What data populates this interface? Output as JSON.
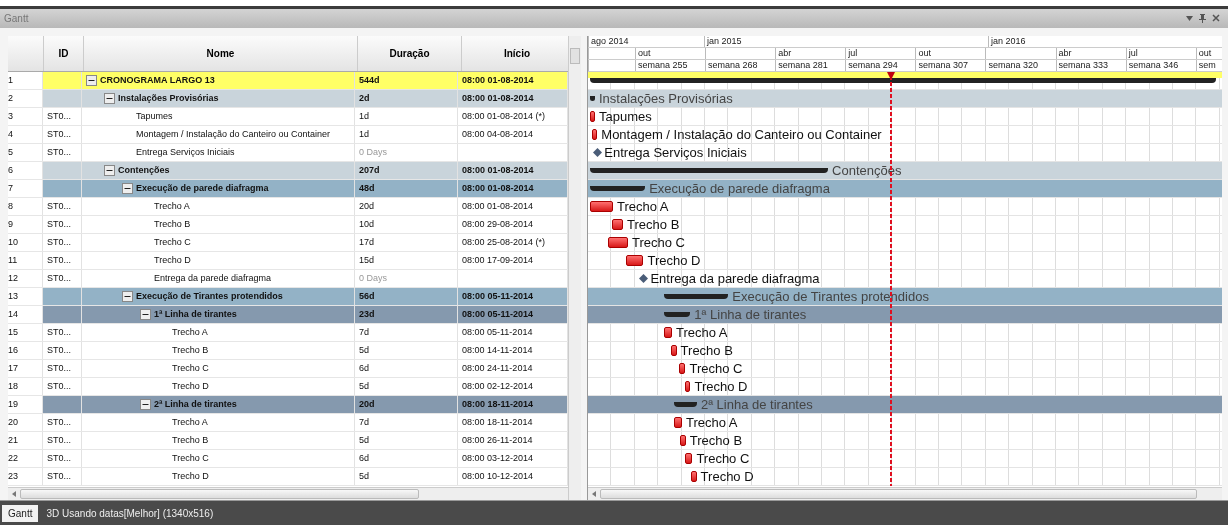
{
  "window": {
    "title": "Gantt"
  },
  "columns": [
    "ID",
    "Nome",
    "Duração",
    "Início"
  ],
  "timeline": {
    "years": [
      "ago 2014",
      "jan 2015",
      "jan 2016"
    ],
    "months": [
      "out",
      "abr",
      "jul",
      "out",
      "abr",
      "jul",
      "out"
    ],
    "weeks": [
      "semana 255",
      "semana 268",
      "semana 281",
      "semana 294",
      "semana 307",
      "semana 320",
      "semana 333",
      "semana 346",
      "sem"
    ]
  },
  "tasks": [
    {
      "kind": "summary",
      "num": "1",
      "name": "CRONOGRAMA LARGO 13",
      "duration": "544d",
      "start": "08:00 01-08-2014",
      "expanded": true,
      "children": [
        {
          "kind": "summary",
          "num": "2",
          "name": "Instalações Provisórias",
          "duration": "2d",
          "start": "08:00 01-08-2014",
          "bar_label": "Instalações Provisórias",
          "expanded": true,
          "children": [
            {
              "kind": "task",
              "num": "3",
              "id": "ST0...",
              "name": "Tapumes",
              "duration": "1d",
              "start": "08:00 01-08-2014 (*)",
              "bar_label": "Tapumes"
            },
            {
              "kind": "task",
              "num": "4",
              "id": "ST0...",
              "name": "Montagem / Instalação do Canteiro ou Container",
              "duration": "1d",
              "start": "08:00 04-08-2014",
              "bar_label": "Montagem / Instalação do Canteiro ou Container"
            },
            {
              "kind": "milestone",
              "num": "5",
              "id": "ST0...",
              "name": "Entrega Serviços Iniciais",
              "duration": "0 Days",
              "bar_label": "Entrega Serviços Iniciais"
            }
          ]
        },
        {
          "kind": "summary",
          "num": "6",
          "name": "Contenções",
          "duration": "207d",
          "start": "08:00 01-08-2014",
          "bar_label": "Contenções",
          "expanded": true,
          "children": [
            {
              "kind": "summary",
              "num": "7",
              "name": "Execução de parede diafragma",
              "duration": "48d",
              "start": "08:00 01-08-2014",
              "bar_label": "Execução de parede diafragma",
              "expanded": true,
              "children": [
                {
                  "kind": "task",
                  "num": "8",
                  "id": "ST0...",
                  "name": "Trecho A",
                  "duration": "20d",
                  "start": "08:00 01-08-2014",
                  "bar_label": "Trecho A"
                },
                {
                  "kind": "task",
                  "num": "9",
                  "id": "ST0...",
                  "name": "Trecho B",
                  "duration": "10d",
                  "start": "08:00 29-08-2014",
                  "bar_label": "Trecho B"
                },
                {
                  "kind": "task",
                  "num": "10",
                  "id": "ST0...",
                  "name": "Trecho C",
                  "duration": "17d",
                  "start": "08:00 25-08-2014 (*)",
                  "bar_label": "Trecho C"
                },
                {
                  "kind": "task",
                  "num": "11",
                  "id": "ST0...",
                  "name": "Trecho D",
                  "duration": "15d",
                  "start": "08:00 17-09-2014",
                  "bar_label": "Trecho D"
                },
                {
                  "kind": "milestone",
                  "num": "12",
                  "id": "ST0...",
                  "name": "Entrega da parede diafragma",
                  "duration": "0 Days",
                  "bar_label": "Entrega da parede diafragma"
                }
              ]
            },
            {
              "kind": "summary",
              "num": "13",
              "name": "Execução de Tirantes protendidos",
              "duration": "56d",
              "start": "08:00 05-11-2014",
              "bar_label": "Execução de Tirantes protendidos",
              "expanded": true,
              "children": [
                {
                  "kind": "summary",
                  "num": "14",
                  "name": "1ª Linha de tirantes",
                  "duration": "23d",
                  "start": "08:00 05-11-2014",
                  "bar_label": "1ª Linha de tirantes",
                  "expanded": true,
                  "children": [
                    {
                      "kind": "task",
                      "num": "15",
                      "id": "ST0...",
                      "name": "Trecho A",
                      "duration": "7d",
                      "start": "08:00 05-11-2014",
                      "bar_label": "Trecho A"
                    },
                    {
                      "kind": "task",
                      "num": "16",
                      "id": "ST0...",
                      "name": "Trecho B",
                      "duration": "5d",
                      "start": "08:00 14-11-2014",
                      "bar_label": "Trecho B"
                    },
                    {
                      "kind": "task",
                      "num": "17",
                      "id": "ST0...",
                      "name": "Trecho C",
                      "duration": "6d",
                      "start": "08:00 24-11-2014",
                      "bar_label": "Trecho C"
                    },
                    {
                      "kind": "task",
                      "num": "18",
                      "id": "ST0...",
                      "name": "Trecho D",
                      "duration": "5d",
                      "start": "08:00 02-12-2014",
                      "bar_label": "Trecho D"
                    }
                  ]
                },
                {
                  "kind": "summary",
                  "num": "19",
                  "name": "2ª Linha de tirantes",
                  "duration": "20d",
                  "start": "08:00 18-11-2014",
                  "bar_label": "2ª Linha de tirantes",
                  "expanded": true,
                  "children": [
                    {
                      "kind": "task",
                      "num": "20",
                      "id": "ST0...",
                      "name": "Trecho A",
                      "duration": "7d",
                      "start": "08:00 18-11-2014",
                      "bar_label": "Trecho A"
                    },
                    {
                      "kind": "task",
                      "num": "21",
                      "id": "ST0...",
                      "name": "Trecho B",
                      "duration": "5d",
                      "start": "08:00 26-11-2014",
                      "bar_label": "Trecho B"
                    },
                    {
                      "kind": "task",
                      "num": "22",
                      "id": "ST0...",
                      "name": "Trecho C",
                      "duration": "6d",
                      "start": "08:00 03-12-2014",
                      "bar_label": "Trecho C"
                    },
                    {
                      "kind": "task",
                      "num": "23",
                      "id": "ST0...",
                      "name": "Trecho D",
                      "duration": "5d",
                      "start": "08:00 10-12-2014",
                      "bar_label": "Trecho D"
                    }
                  ]
                }
              ]
            }
          ]
        }
      ]
    }
  ],
  "bottom_tabs": [
    {
      "label": "Gantt",
      "selected": true
    },
    {
      "label": "3D Usando datas[Melhor] (1340x516)",
      "selected": false
    }
  ]
}
